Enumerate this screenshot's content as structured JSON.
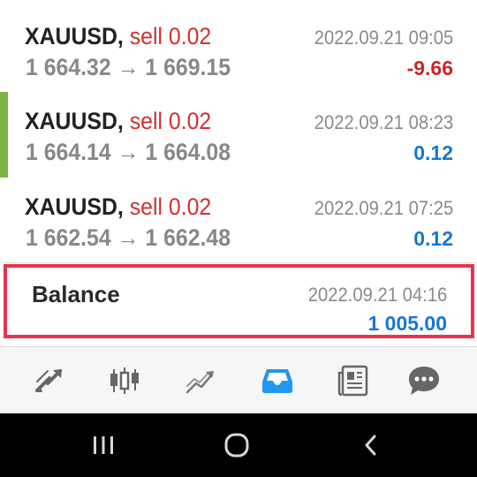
{
  "colors": {
    "sell": "#d32f2f",
    "loss": "#c62828",
    "gain": "#1976d2",
    "highlight_border": "#e8334f",
    "accent_bar": "#7cb342",
    "active_tab": "#2196f3",
    "inactive_tab": "#666666"
  },
  "deals": [
    {
      "symbol": "XAUUSD,",
      "direction": "sell 0.02",
      "open_price": "1 664.32",
      "arrow": "→",
      "close_price": "1 669.15",
      "time": "2022.09.21 09:05",
      "profit": "-9.66",
      "profit_status": "loss"
    },
    {
      "symbol": "XAUUSD,",
      "direction": "sell 0.02",
      "open_price": "1 664.14",
      "arrow": "→",
      "close_price": "1 664.08",
      "time": "2022.09.21 08:23",
      "profit": "0.12",
      "profit_status": "gain",
      "selected": true
    },
    {
      "symbol": "XAUUSD,",
      "direction": "sell 0.02",
      "open_price": "1 662.54",
      "arrow": "→",
      "close_price": "1 662.48",
      "time": "2022.09.21 07:25",
      "profit": "0.12",
      "profit_status": "gain"
    }
  ],
  "balance": {
    "label": "Balance",
    "time": "2022.09.21 04:16",
    "amount": "1 005.00"
  },
  "tabs": [
    {
      "name": "quotes",
      "icon": "quotes-arrows-icon",
      "active": false
    },
    {
      "name": "chart",
      "icon": "candlestick-chart-icon",
      "active": false
    },
    {
      "name": "trade",
      "icon": "trade-trend-icon",
      "active": false
    },
    {
      "name": "history",
      "icon": "inbox-tray-icon",
      "active": true
    },
    {
      "name": "news",
      "icon": "newspaper-icon",
      "active": false
    },
    {
      "name": "messages",
      "icon": "chat-bubble-icon",
      "active": false
    }
  ],
  "system_nav": [
    {
      "name": "recent-apps",
      "icon": "recent-apps-icon"
    },
    {
      "name": "home",
      "icon": "home-circle-icon"
    },
    {
      "name": "back",
      "icon": "back-chevron-icon"
    }
  ]
}
